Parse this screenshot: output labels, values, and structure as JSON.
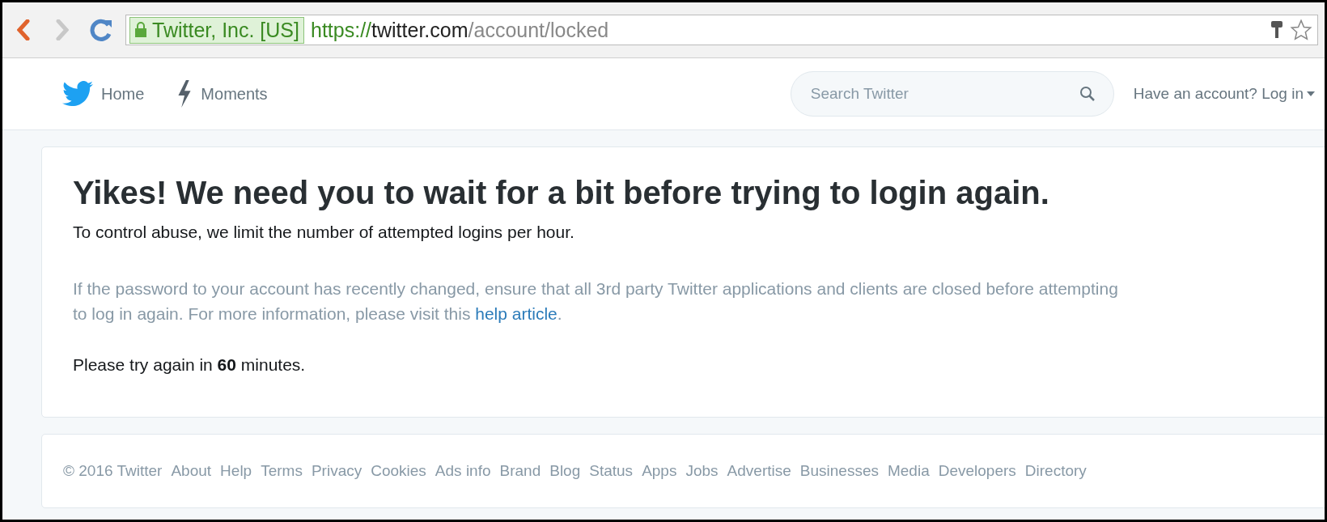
{
  "browser": {
    "identity": "Twitter, Inc. [US]",
    "url": {
      "scheme": "https://",
      "host": "twitter.com",
      "path": "/account/locked"
    }
  },
  "nav": {
    "items": [
      {
        "kind": "bird",
        "label": "Home"
      },
      {
        "kind": "bolt",
        "label": "Moments"
      }
    ],
    "search": {
      "placeholder": "Search Twitter"
    },
    "login": "Have an account? Log in"
  },
  "message": {
    "title": "Yikes! We need you to wait for a bit before trying to login again.",
    "subtitle": "To control abuse, we limit the number of attempted logins per hour.",
    "note": {
      "before": "If the password to your account has recently changed, ensure that all 3rd party Twitter applications and clients are closed before attempting to log in again. For more information, please visit this ",
      "link": "help article",
      "after": "."
    },
    "retry": "Please try again in **60** minutes."
  },
  "footer": [
    "© 2016 Twitter",
    "About",
    "Help",
    "Terms",
    "Privacy",
    "Cookies",
    "Ads info",
    "Brand",
    "Blog",
    "Status",
    "Apps",
    "Jobs",
    "Advertise",
    "Businesses",
    "Media",
    "Developers",
    "Directory"
  ]
}
